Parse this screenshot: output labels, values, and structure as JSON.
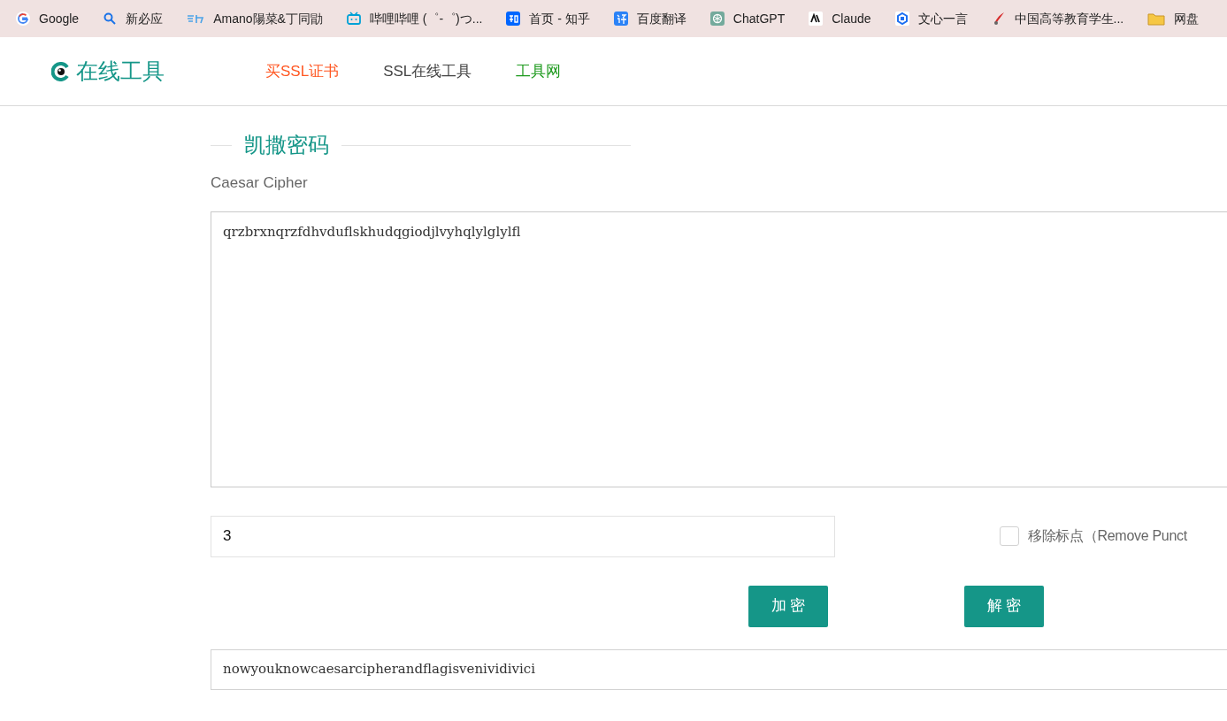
{
  "bookmarks": [
    {
      "label": "Google",
      "kind": "google"
    },
    {
      "label": "新必应",
      "kind": "search"
    },
    {
      "label": "Amano陽菜&丁同勖",
      "kind": "wordmark"
    },
    {
      "label": "哔哩哔哩 (゜-゜)つ...",
      "kind": "tv"
    },
    {
      "label": "首页 - 知乎",
      "kind": "zhi"
    },
    {
      "label": "百度翻译",
      "kind": "yi"
    },
    {
      "label": "ChatGPT",
      "kind": "knot"
    },
    {
      "label": "Claude",
      "kind": "slash"
    },
    {
      "label": "文心一言",
      "kind": "cube"
    },
    {
      "label": "中国高等教育学生...",
      "kind": "bird"
    },
    {
      "label": "网盘",
      "kind": "folder"
    }
  ],
  "site": {
    "title": "在线工具"
  },
  "nav": [
    {
      "label": "买SSL证书",
      "color": "#ff5722"
    },
    {
      "label": "SSL在线工具",
      "color": "#444444"
    },
    {
      "label": "工具网",
      "color": "#1e9a1e"
    }
  ],
  "tool": {
    "title": "凯撒密码",
    "subtitle": "Caesar Cipher"
  },
  "input": {
    "value": "qrzbrxnqrzfdhvduflskhudqgiodjlvyhqlylglylfl"
  },
  "shift": {
    "value": "3"
  },
  "remove_punctuation": {
    "label": "移除标点（Remove Punct",
    "checked": false
  },
  "buttons": [
    "加 密",
    "解 密"
  ],
  "output": {
    "value": "nowyouknowcaesarcipherandflagisvenividivici"
  }
}
